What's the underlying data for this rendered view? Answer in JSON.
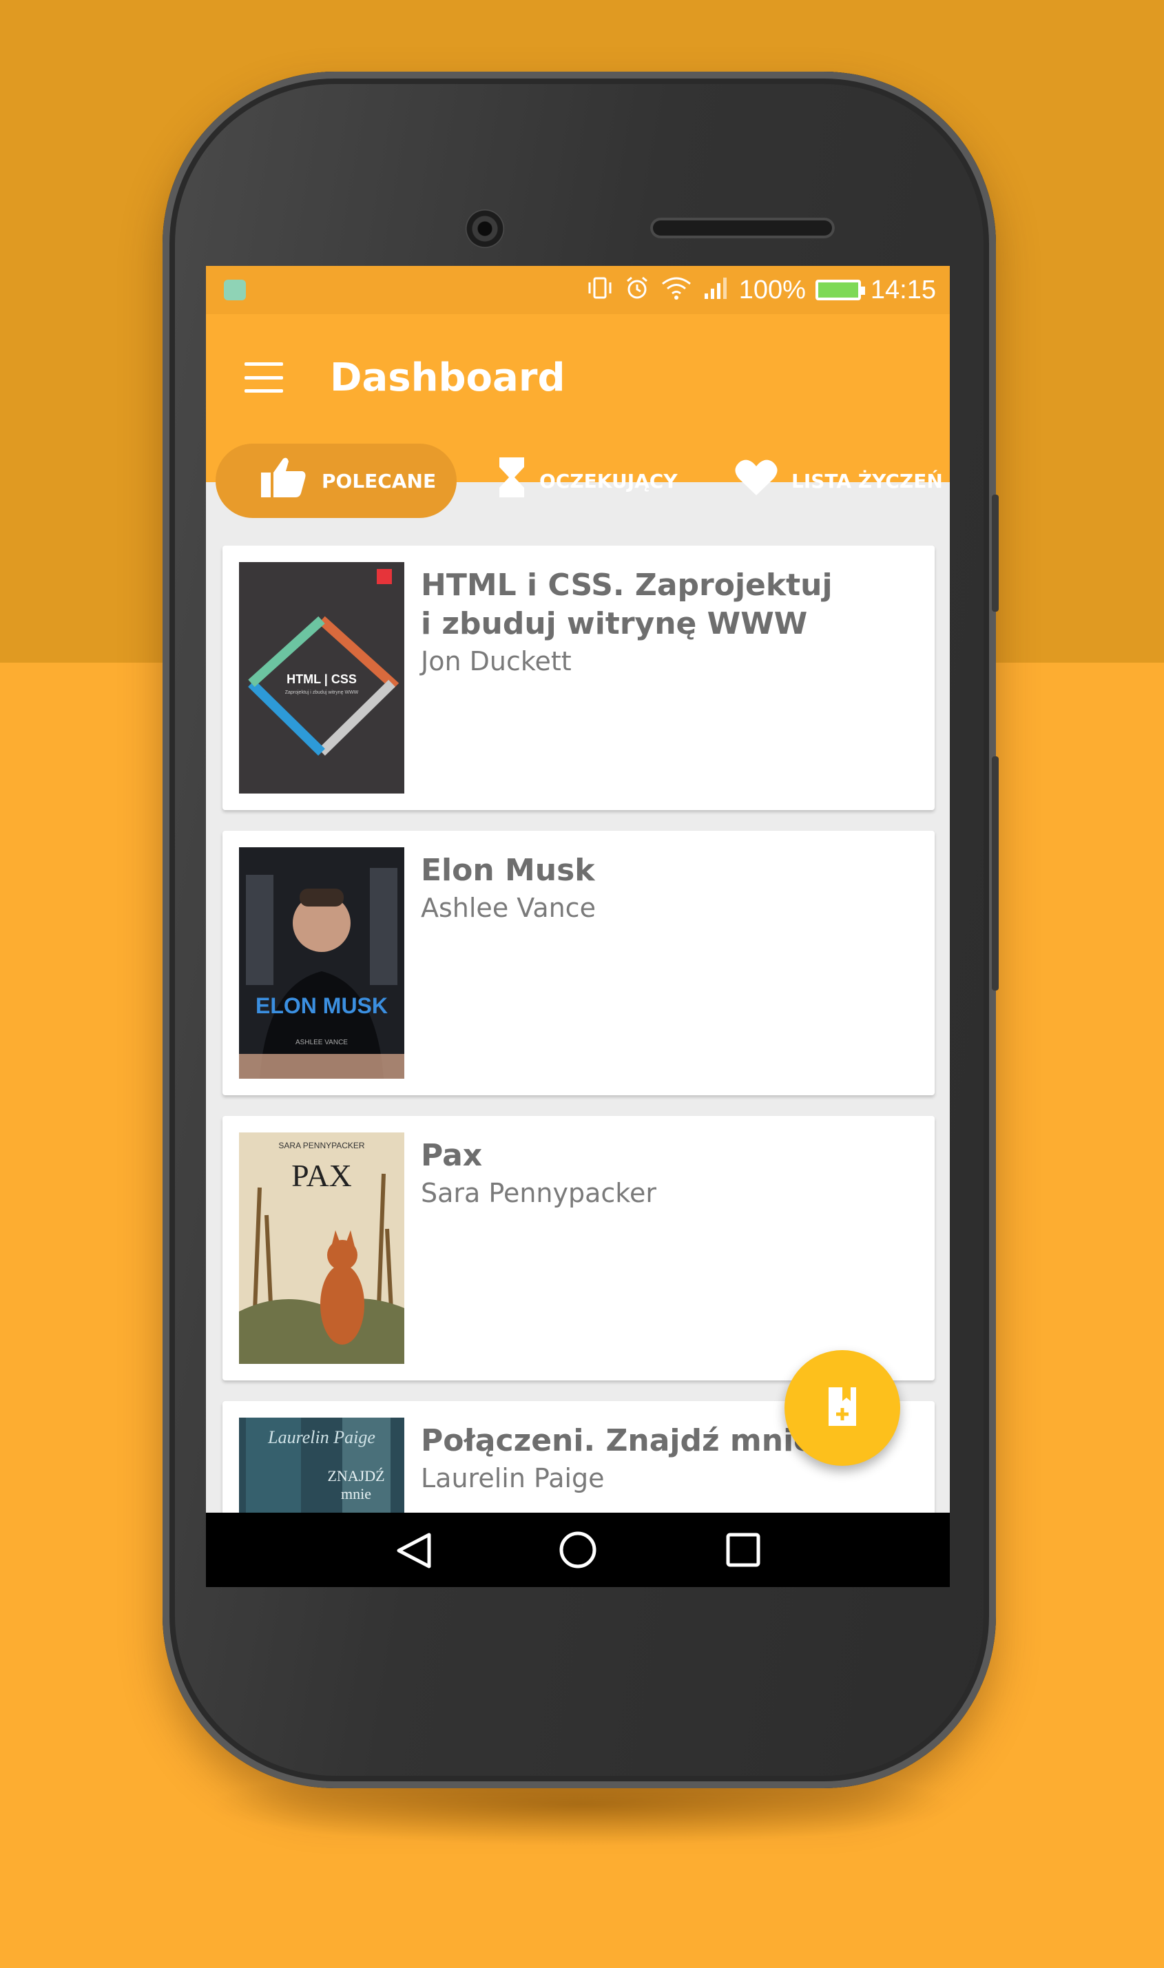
{
  "status_bar": {
    "battery_percent": "100%",
    "time": "14:15",
    "icons": [
      "android-notification-icon",
      "vibrate-icon",
      "alarm-icon",
      "wifi-icon",
      "signal-icon",
      "battery-charging-icon"
    ]
  },
  "app_bar": {
    "title": "Dashboard",
    "menu_icon": "hamburger-menu-icon"
  },
  "tabs": [
    {
      "label": "POLECANE",
      "icon": "thumbs-up-icon",
      "active": true
    },
    {
      "label": "OCZEKUJĄCY",
      "icon": "hourglass-icon",
      "active": false
    },
    {
      "label": "LISTA ŻYCZEŃ",
      "icon": "heart-icon",
      "active": false
    }
  ],
  "books": [
    {
      "title": "HTML i CSS. Zaprojektuj i zbuduj witrynę WWW",
      "author": "Jon Duckett",
      "cover_text": "HTML | CSS",
      "cover_sub": "Zaprojektuj i zbuduj witrynę WWW"
    },
    {
      "title": "Elon Musk",
      "author": "Ashlee Vance",
      "cover_text": "ELON MUSK",
      "cover_sub": "ASHLEE VANCE"
    },
    {
      "title": "Pax",
      "author": "Sara Pennypacker",
      "cover_text": "PAX",
      "cover_sub": "SARA PENNYPACKER"
    },
    {
      "title": "Połączeni. Znajdź mnie",
      "author": "Laurelin Paige",
      "cover_text": "ZNAJDŹ mnie",
      "cover_sub": "Laurelin Paige"
    }
  ],
  "fab": {
    "icon": "add-book-icon"
  },
  "nav_bar": {
    "icons": [
      "back-icon",
      "home-icon",
      "recents-icon"
    ]
  },
  "colors": {
    "background": "#FDAD31",
    "background_top": "#E09A22",
    "app_bar": "#FDAD31",
    "active_tab": "#E89B2B",
    "fab": "#FDC01C",
    "card_text": "#6e6e6e"
  }
}
